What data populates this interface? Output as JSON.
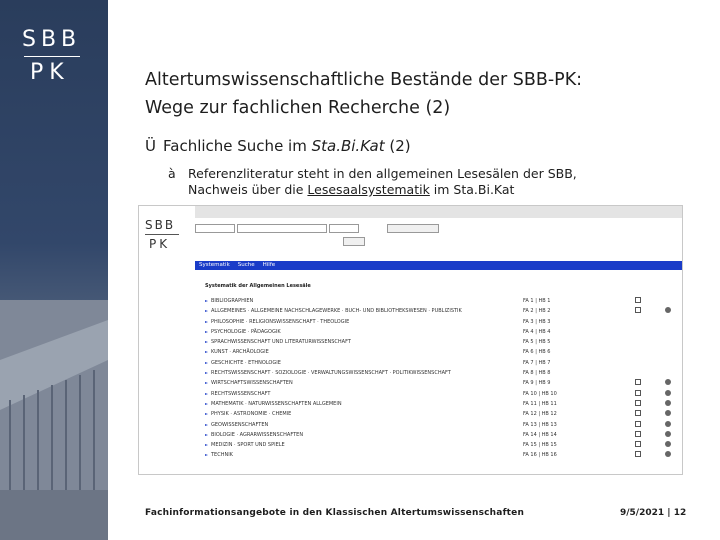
{
  "logo": {
    "line1": "SBB",
    "line2": "PK"
  },
  "slide": {
    "title_line1": "Altertumswissenschaftliche Bestände der SBB-PK:",
    "title_line2": "Wege zur fachlichen Recherche (2)",
    "bullet1_arrow": "Ü",
    "bullet1_text": "Fachliche Suche im ",
    "bullet1_emph": "Sta.Bi.Kat",
    "bullet1_tail": " (2)",
    "bullet2_arrow": "à",
    "bullet2_line1": "Referenzliteratur steht in den allgemeinen Lesesälen der SBB,",
    "bullet2_line2_pre": "Nachweis über die ",
    "bullet2_link": "Lesesaalsystematik",
    "bullet2_line2_post": " im Sta.Bi.Kat"
  },
  "screenshot": {
    "logo_line1": "SBB",
    "logo_line2": "PK",
    "nav": [
      "Systematik",
      "Suche",
      "Hilfe"
    ],
    "list_title": "Systematik der Allgemeinen Lesesäle",
    "rows": [
      {
        "name": "BIBLIOGRAPHIEN",
        "code": "FA 1 | HB 1",
        "ic1": true,
        "ic2": false
      },
      {
        "name": "ALLGEMEINES · ALLGEMEINE NACHSCHLAGEWERKE · BUCH- UND BIBLIOTHEKSWESEN · PUBLIZISTIK",
        "code": "FA 2 | HB 2",
        "ic1": true,
        "ic2": true
      },
      {
        "name": "PHILOSOPHIE · RELIGIONSWISSENSCHAFT · THEOLOGIE",
        "code": "FA 3 | HB 3",
        "ic1": false,
        "ic2": false
      },
      {
        "name": "PSYCHOLOGIE · PÄDAGOGIK",
        "code": "FA 4 | HB 4",
        "ic1": false,
        "ic2": false
      },
      {
        "name": "SPRACHWISSENSCHAFT UND LITERATURWISSENSCHAFT",
        "code": "FA 5 | HB 5",
        "ic1": false,
        "ic2": false
      },
      {
        "name": "KUNST · ARCHÄOLOGIE",
        "code": "FA 6 | HB 6",
        "ic1": false,
        "ic2": false
      },
      {
        "name": "GESCHICHTE · ETHNOLOGIE",
        "code": "FA 7 | HB 7",
        "ic1": false,
        "ic2": false
      },
      {
        "name": "RECHTSWISSENSCHAFT · SOZIOLOGIE · VERWALTUNGSWISSENSCHAFT · POLITIKWISSENSCHAFT",
        "code": "FA 8 | HB 8",
        "ic1": false,
        "ic2": false
      },
      {
        "name": "WIRTSCHAFTSWISSENSCHAFTEN",
        "code": "FA 9 | HB 9",
        "ic1": true,
        "ic2": true
      },
      {
        "name": "RECHTSWISSENSCHAFT",
        "code": "FA 10 | HB 10",
        "ic1": true,
        "ic2": true
      },
      {
        "name": "MATHEMATIK · NATURWISSENSCHAFTEN ALLGEMEIN",
        "code": "FA 11 | HB 11",
        "ic1": true,
        "ic2": true
      },
      {
        "name": "PHYSIK · ASTRONOMIE · CHEMIE",
        "code": "FA 12 | HB 12",
        "ic1": true,
        "ic2": true
      },
      {
        "name": "GEOWISSENSCHAFTEN",
        "code": "FA 13 | HB 13",
        "ic1": true,
        "ic2": true
      },
      {
        "name": "BIOLOGIE · AGRARWISSENSCHAFTEN",
        "code": "FA 14 | HB 14",
        "ic1": true,
        "ic2": true
      },
      {
        "name": "MEDIZIN · SPORT UND SPIELE",
        "code": "FA 15 | HB 15",
        "ic1": true,
        "ic2": true
      },
      {
        "name": "TECHNIK",
        "code": "FA 16 | HB 16",
        "ic1": true,
        "ic2": true
      }
    ]
  },
  "footer": {
    "left": "Fachinformationsangebote in den Klassischen Altertumswissenschaften",
    "right": "9/5/2021 | 12"
  }
}
